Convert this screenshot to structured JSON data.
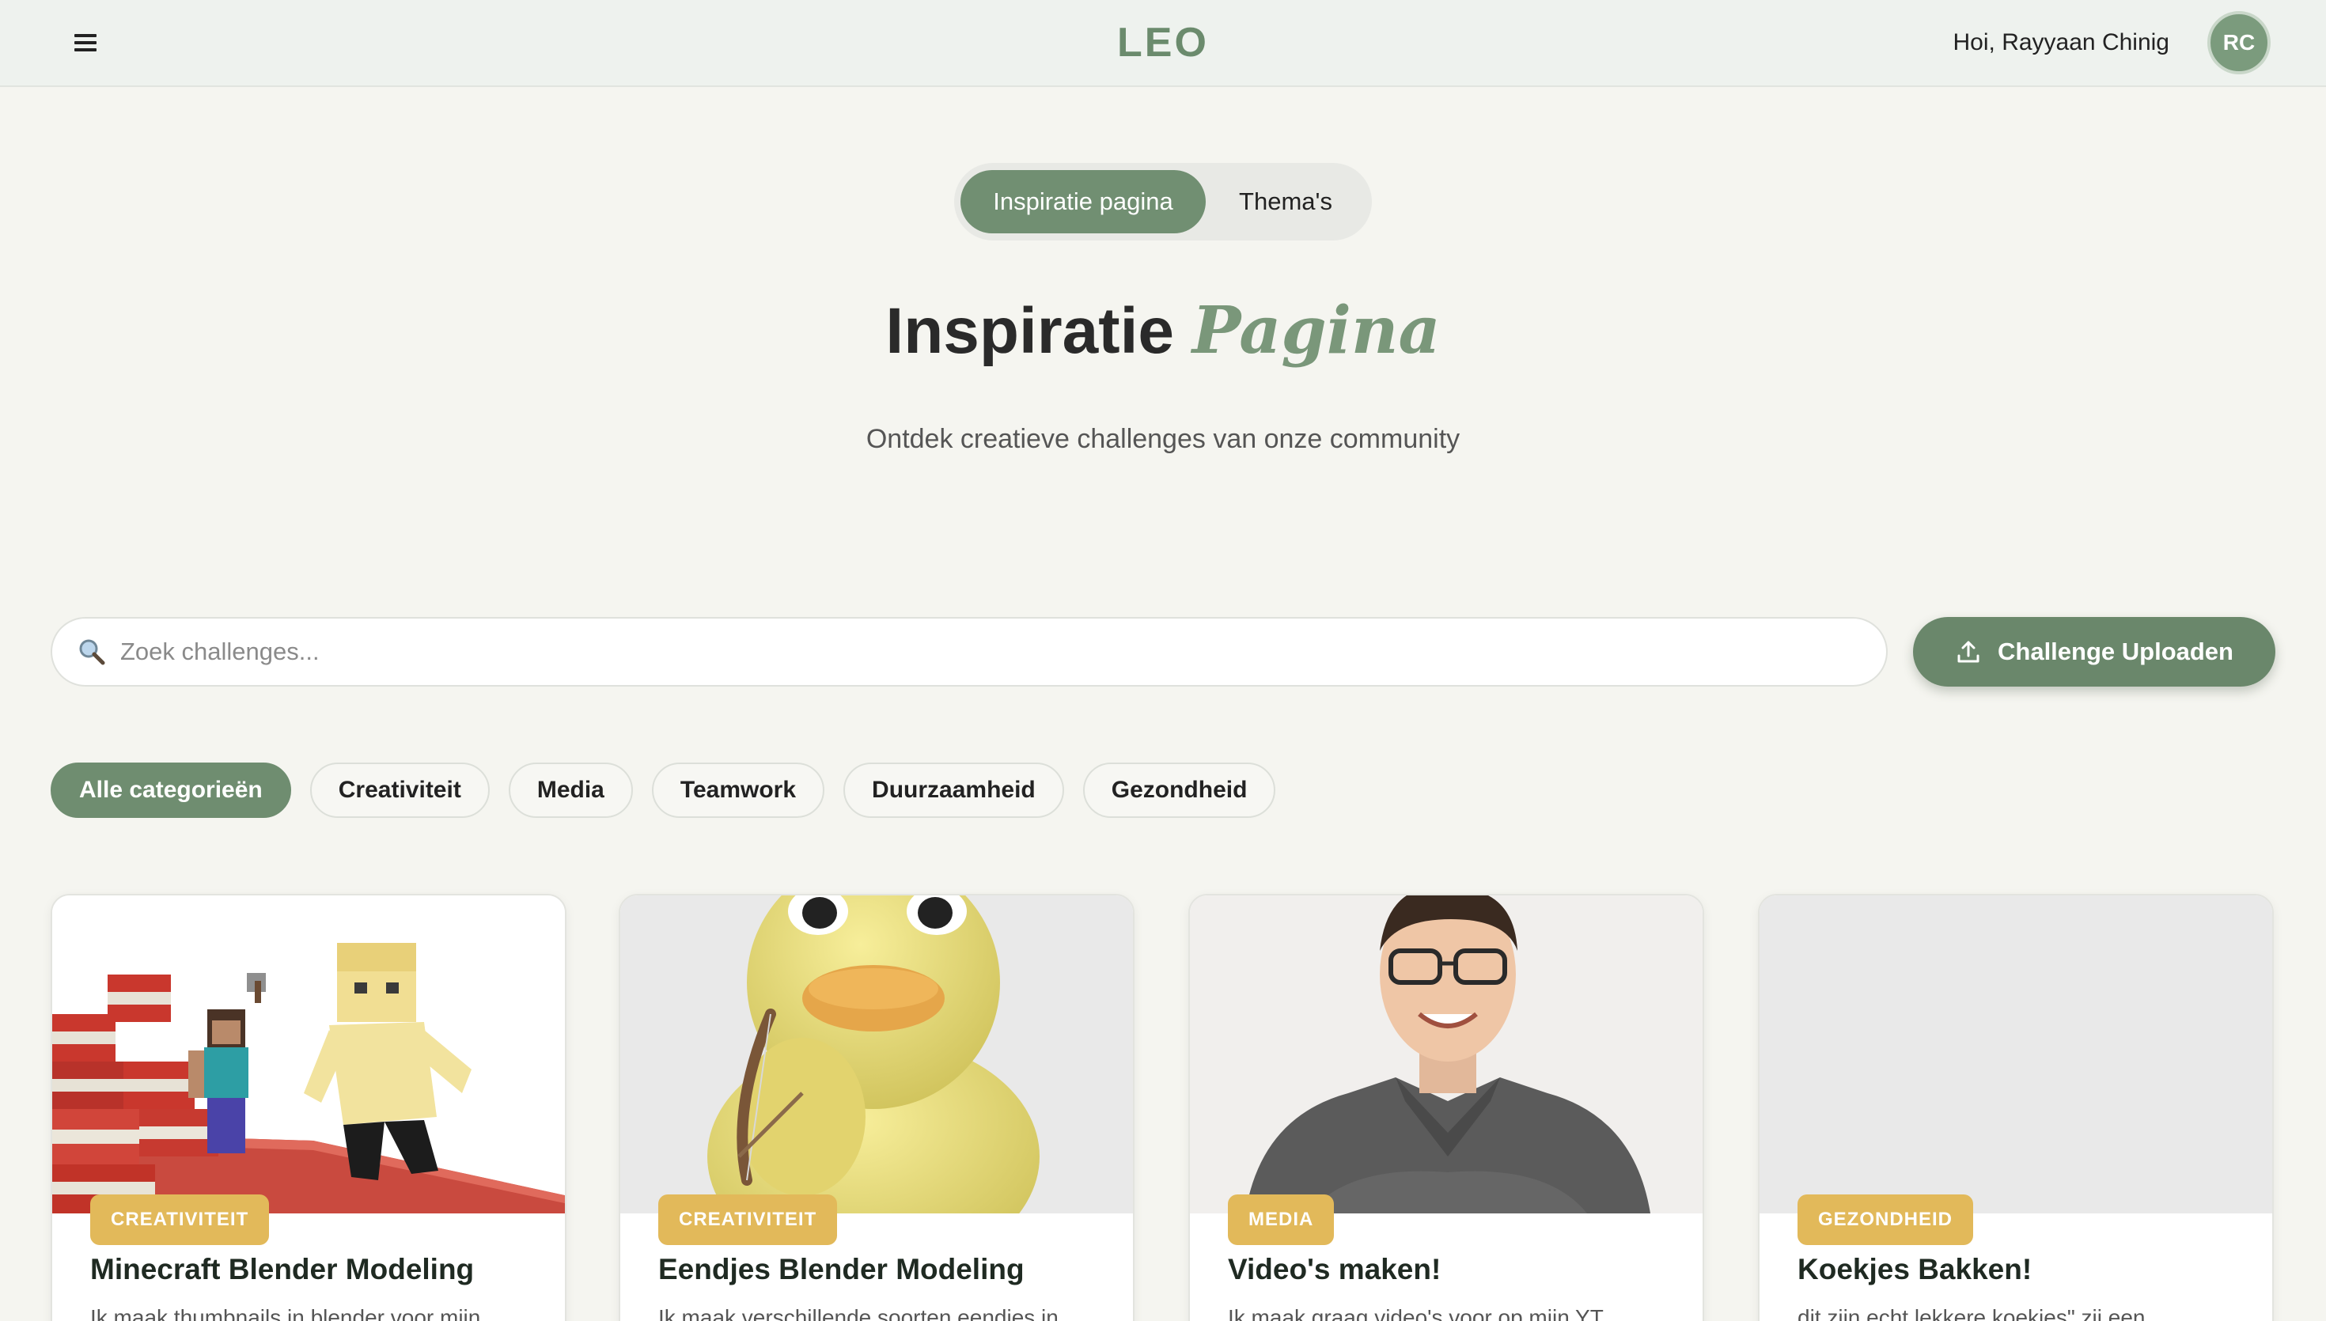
{
  "header": {
    "menu_icon": "hamburger-icon",
    "logo": "LEO",
    "greeting": "Hoi, Rayyaan Chinig",
    "avatar_initials": "RC"
  },
  "toggle": {
    "active": "Inspiratie pagina",
    "inactive": "Thema's"
  },
  "hero": {
    "title_strong": "Inspiratie",
    "title_accent": "Pagina",
    "subtitle": "Ontdek creatieve challenges van onze community"
  },
  "search": {
    "icon": "search-icon",
    "placeholder": "Zoek challenges...",
    "value": ""
  },
  "upload": {
    "icon": "upload-icon",
    "label": "Challenge Uploaden"
  },
  "filters": [
    "Alle categorieën",
    "Creativiteit",
    "Media",
    "Teamwork",
    "Duurzaamheid",
    "Gezondheid"
  ],
  "cards": [
    {
      "badge": "CREATIVITEIT",
      "title": "Minecraft Blender Modeling",
      "description": "Ik maak thumbnails in blender voor mijn"
    },
    {
      "badge": "CREATIVITEIT",
      "title": "Eendjes Blender Modeling",
      "description": "Ik maak verschillende soorten eendjes in"
    },
    {
      "badge": "MEDIA",
      "title": "Video's maken!",
      "description": "Ik maak graag video's voor op mijn YT"
    },
    {
      "badge": "GEZONDHEID",
      "title": "Koekjes Bakken!",
      "description": "dit zijn echt lekkere koekjes\" zij een"
    }
  ],
  "colors": {
    "primary": "#6f8d70",
    "badge": "#e2b95a",
    "background": "#f5f5f0",
    "logo": "#6b8b6d"
  }
}
